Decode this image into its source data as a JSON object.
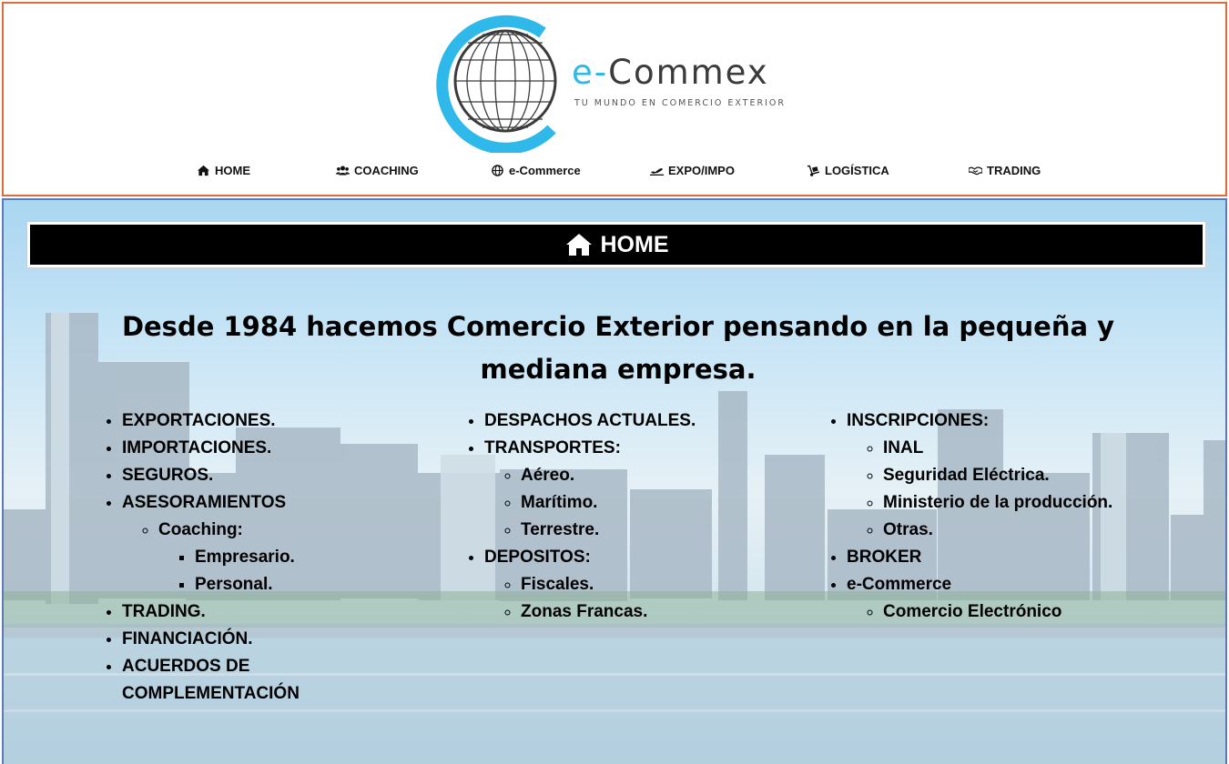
{
  "brand": {
    "name_prefix": "e-",
    "name_rest": "Commex",
    "tagline": "TU MUNDO EN COMERCIO EXTERIOR",
    "accent_color": "#2fb8ea"
  },
  "nav": [
    {
      "label": "HOME",
      "icon": "home-icon"
    },
    {
      "label": "COACHING",
      "icon": "users-icon"
    },
    {
      "label": "e-Commerce",
      "icon": "globe-icon"
    },
    {
      "label": "EXPO/IMPO",
      "icon": "plane-icon"
    },
    {
      "label": "LOGÍSTICA",
      "icon": "dolly-icon"
    },
    {
      "label": "TRADING",
      "icon": "handshake-icon"
    }
  ],
  "banner": {
    "title": "HOME",
    "icon": "home-icon"
  },
  "headline": "Desde 1984 hacemos Comercio Exterior pensando en la pequeña y mediana empresa.",
  "columns": {
    "col1": {
      "exportaciones": "EXPORTACIONES.",
      "importaciones": "IMPORTACIONES.",
      "seguros": "SEGUROS.",
      "asesoramientos": "ASESORAMIENTOS",
      "coaching": "Coaching:",
      "empresario": "Empresario.",
      "personal": "Personal.",
      "trading": "TRADING.",
      "financiacion": "FINANCIACIÓN.",
      "acuerdos": "ACUERDOS DE COMPLEMENTACIÓN"
    },
    "col2": {
      "despachos": "DESPACHOS ACTUALES.",
      "transportes": "TRANSPORTES:",
      "aereo": "Aéreo.",
      "maritimo": "Marítimo.",
      "terrestre": "Terrestre.",
      "depositos": "DEPOSITOS:",
      "fiscales": "Fiscales.",
      "zonas_francas": "Zonas Francas."
    },
    "col3": {
      "inscripciones": "INSCRIPCIONES:",
      "inal": "INAL",
      "seguridad": "Seguridad Eléctrica.",
      "ministerio": "Ministerio de la producción.",
      "otras": "Otras.",
      "broker": "BROKER",
      "ecommerce": "e-Commerce",
      "comercio_electronico": "Comercio Electrónico"
    }
  }
}
